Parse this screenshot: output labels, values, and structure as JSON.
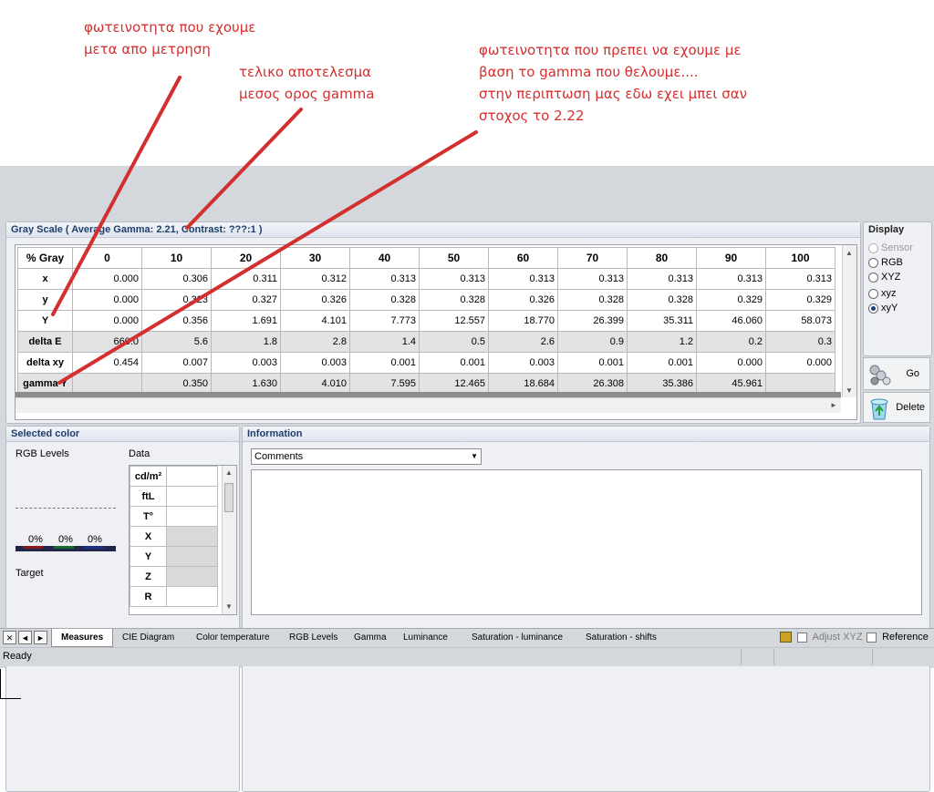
{
  "annotations": {
    "note1": [
      "φωτεινοτητα που εχουμε",
      "μετα απο μετρηση"
    ],
    "note2": [
      "τελικο αποτελεσμα",
      "μεσος ορος gamma"
    ],
    "note3": [
      "φωτεινοτητα που πρεπει να εχουμε με",
      "βαση το gamma που θελουμε....",
      "στην περιπτωση μας εδω εχει μπει σαν",
      "στοχος το 2.22"
    ],
    "color": "#d32f2f"
  },
  "grayscale": {
    "title": "Gray Scale ( Average Gamma: 2.21, Contrast: ???:1 )",
    "headers": [
      "% Gray",
      "0",
      "10",
      "20",
      "30",
      "40",
      "50",
      "60",
      "70",
      "80",
      "90",
      "100"
    ],
    "rows": [
      {
        "label": "x",
        "values": [
          "0.000",
          "0.306",
          "0.311",
          "0.312",
          "0.313",
          "0.313",
          "0.313",
          "0.313",
          "0.313",
          "0.313",
          "0.313"
        ]
      },
      {
        "label": "y",
        "values": [
          "0.000",
          "0.323",
          "0.327",
          "0.326",
          "0.328",
          "0.328",
          "0.326",
          "0.328",
          "0.328",
          "0.329",
          "0.329"
        ]
      },
      {
        "label": "Y",
        "values": [
          "0.000",
          "0.356",
          "1.691",
          "4.101",
          "7.773",
          "12.557",
          "18.770",
          "26.399",
          "35.311",
          "46.060",
          "58.073"
        ]
      },
      {
        "label": "delta E",
        "values": [
          "660.0",
          "5.6",
          "1.8",
          "2.8",
          "1.4",
          "0.5",
          "2.6",
          "0.9",
          "1.2",
          "0.2",
          "0.3"
        ]
      },
      {
        "label": "delta xy",
        "values": [
          "0.454",
          "0.007",
          "0.003",
          "0.003",
          "0.001",
          "0.001",
          "0.003",
          "0.001",
          "0.001",
          "0.000",
          "0.000"
        ]
      },
      {
        "label": "gamma Y",
        "values": [
          "",
          "0.350",
          "1.630",
          "4.010",
          "7.595",
          "12.465",
          "18.684",
          "26.308",
          "35.386",
          "45.961",
          ""
        ]
      }
    ]
  },
  "display": {
    "title": "Display",
    "options": [
      {
        "label": "Sensor",
        "selected": false,
        "enabled": false
      },
      {
        "label": "RGB",
        "selected": false,
        "enabled": true
      },
      {
        "label": "XYZ",
        "selected": false,
        "enabled": true
      },
      {
        "label": "xyz",
        "selected": false,
        "enabled": true
      },
      {
        "label": "xyY",
        "selected": true,
        "enabled": true
      }
    ]
  },
  "buttons": {
    "go": "Go",
    "delete": "Delete"
  },
  "selected_color": {
    "title": "Selected color",
    "rgb_levels": "RGB Levels",
    "data": "Data",
    "percents": [
      "0%",
      "0%",
      "0%"
    ],
    "target": "Target",
    "rows": [
      "cd/m²",
      "ftL",
      "T°",
      "X",
      "Y",
      "Z",
      "R"
    ]
  },
  "information": {
    "title": "Information",
    "dropdown_value": "Comments"
  },
  "tabs": [
    "Measures",
    "CIE Diagram",
    "Color temperature",
    "RGB Levels",
    "Gamma",
    "Luminance",
    "Saturation - luminance",
    "Saturation - shifts"
  ],
  "toolbar_right": {
    "adjust_xyz": "Adjust XYZ",
    "reference": "Reference"
  },
  "status": "Ready"
}
